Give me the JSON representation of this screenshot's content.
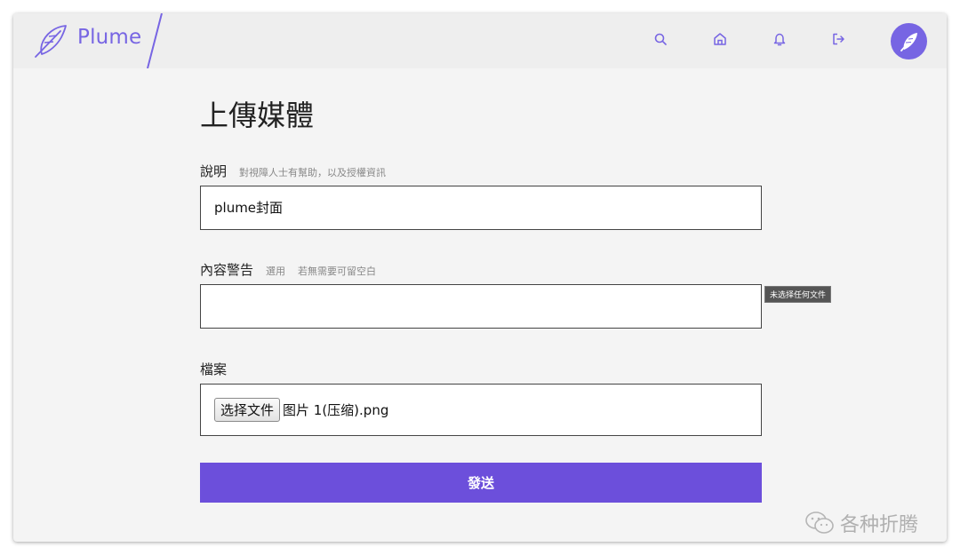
{
  "header": {
    "brand": "Plume",
    "nav": [
      {
        "icon": "search-icon"
      },
      {
        "icon": "home-icon"
      },
      {
        "icon": "bell-icon"
      },
      {
        "icon": "logout-icon"
      }
    ],
    "avatar_icon": "feather-icon"
  },
  "page": {
    "title": "上傳媒體"
  },
  "form": {
    "description": {
      "label": "說明",
      "hint": "對視障人士有幫助，以及授權資訊",
      "value": "plume封面"
    },
    "content_warning": {
      "label": "內容警告",
      "hint_optional": "選用",
      "hint": "若無需要可留空白",
      "value": ""
    },
    "file": {
      "label": "檔案",
      "button_label": "选择文件",
      "file_name": "图片 1(压缩).png"
    },
    "tooltip": "未选择任何文件",
    "submit_label": "發送"
  },
  "watermark": {
    "text": "各种折腾"
  },
  "colors": {
    "accent": "#7765e3",
    "button": "#6c4fdb",
    "header_bg": "#eeeeee",
    "page_bg": "#f4f4f4"
  }
}
